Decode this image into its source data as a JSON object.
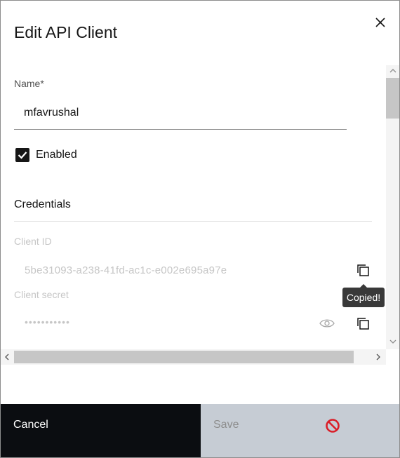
{
  "modal": {
    "title": "Edit API Client"
  },
  "form": {
    "name_label": "Name*",
    "name_value": "mfavrushal",
    "enabled_label": "Enabled",
    "enabled_checked": true
  },
  "credentials": {
    "section_title": "Credentials",
    "client_id_label": "Client ID",
    "client_id_value": "5be31093-a238-41fd-ac1c-e002e695a97e",
    "client_secret_label": "Client secret",
    "client_secret_value": "•••••••••••",
    "tooltip_text": "Copied!"
  },
  "footer": {
    "cancel_label": "Cancel",
    "save_label": "Save"
  },
  "colors": {
    "primary_dark": "#0b0d11",
    "disabled_button": "#c6ccd4",
    "danger_red": "#da1e28"
  }
}
